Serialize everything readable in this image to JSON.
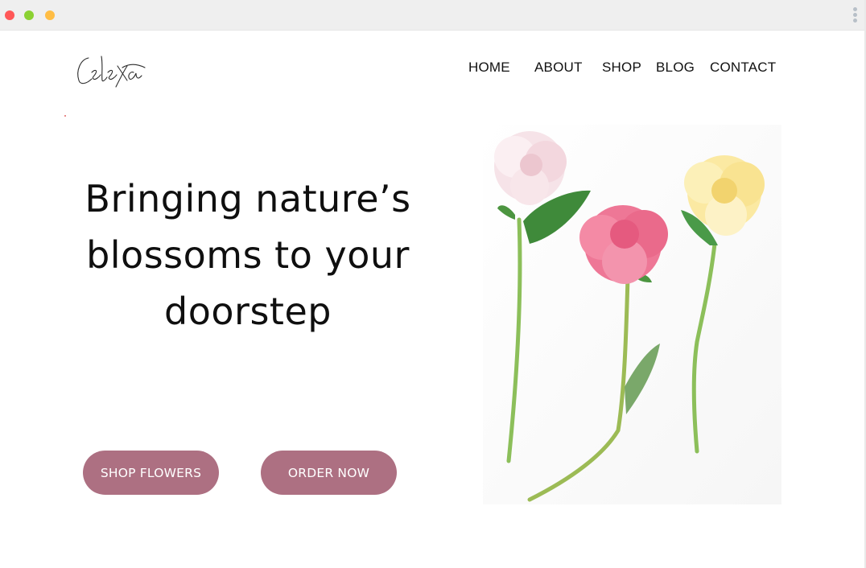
{
  "window": {
    "controls": [
      "close",
      "minimize",
      "maximize"
    ],
    "colors": {
      "close": "#ff5757",
      "minimize": "#8bd132",
      "maximize": "#ffbd44"
    },
    "menu_icon": "kebab-menu-icon"
  },
  "brand": {
    "logo_text": "Celexa"
  },
  "nav": {
    "items": [
      "HOME",
      "ABOUT",
      "SHOP",
      "BLOG",
      "CONTACT"
    ]
  },
  "hero": {
    "title_lines": [
      "Bringing nature’s",
      "blossoms to your",
      "doorstep"
    ],
    "shop_button": "SHOP FLOWERS",
    "order_button": "ORDER NOW"
  },
  "theme": {
    "button_color": "#ad7082",
    "text_color": "#0f0f0f"
  },
  "image": {
    "subject": "three peonies: pale pink, hot pink, yellow on white background"
  }
}
